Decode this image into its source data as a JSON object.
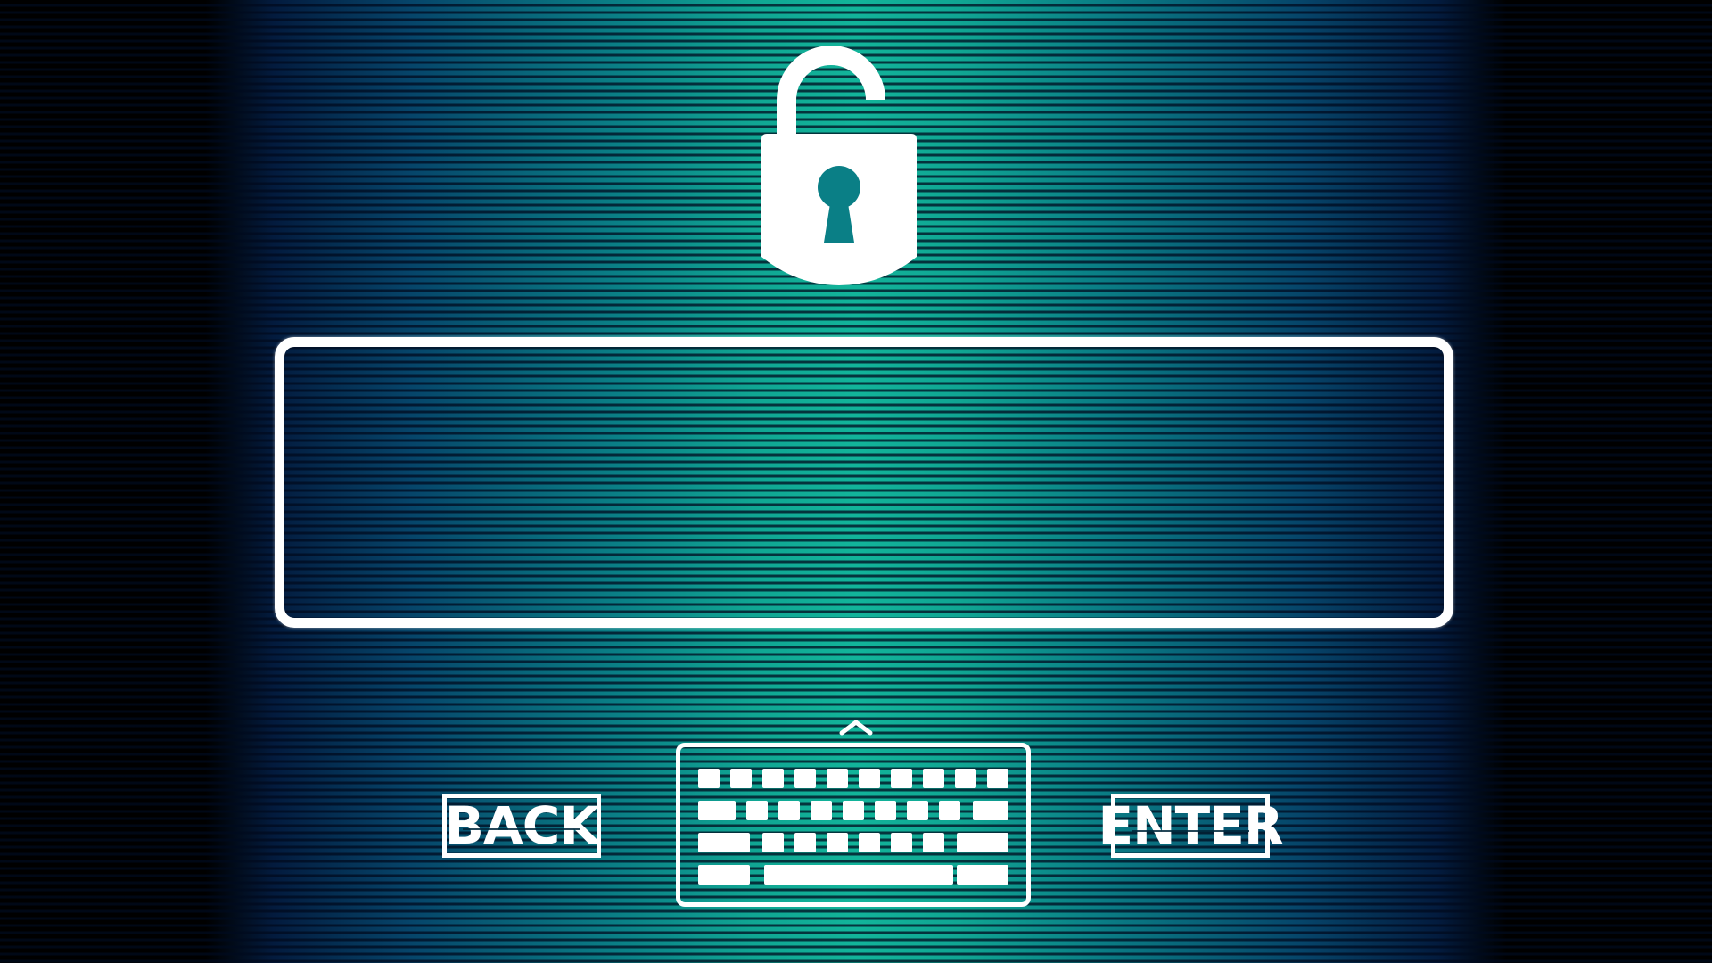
{
  "screen": {
    "title": "",
    "background_accent": "#12b49a",
    "background_edge": "#000000",
    "foreground": "#ffffff"
  },
  "lock": {
    "icon": "unlocked-padlock-icon"
  },
  "password_field": {
    "value": "",
    "placeholder": ""
  },
  "buttons": {
    "back_label": "BACK",
    "enter_label": "ENTER"
  },
  "keyboard": {
    "icon": "keyboard-icon",
    "chevron_icon": "chevron-up-icon"
  }
}
